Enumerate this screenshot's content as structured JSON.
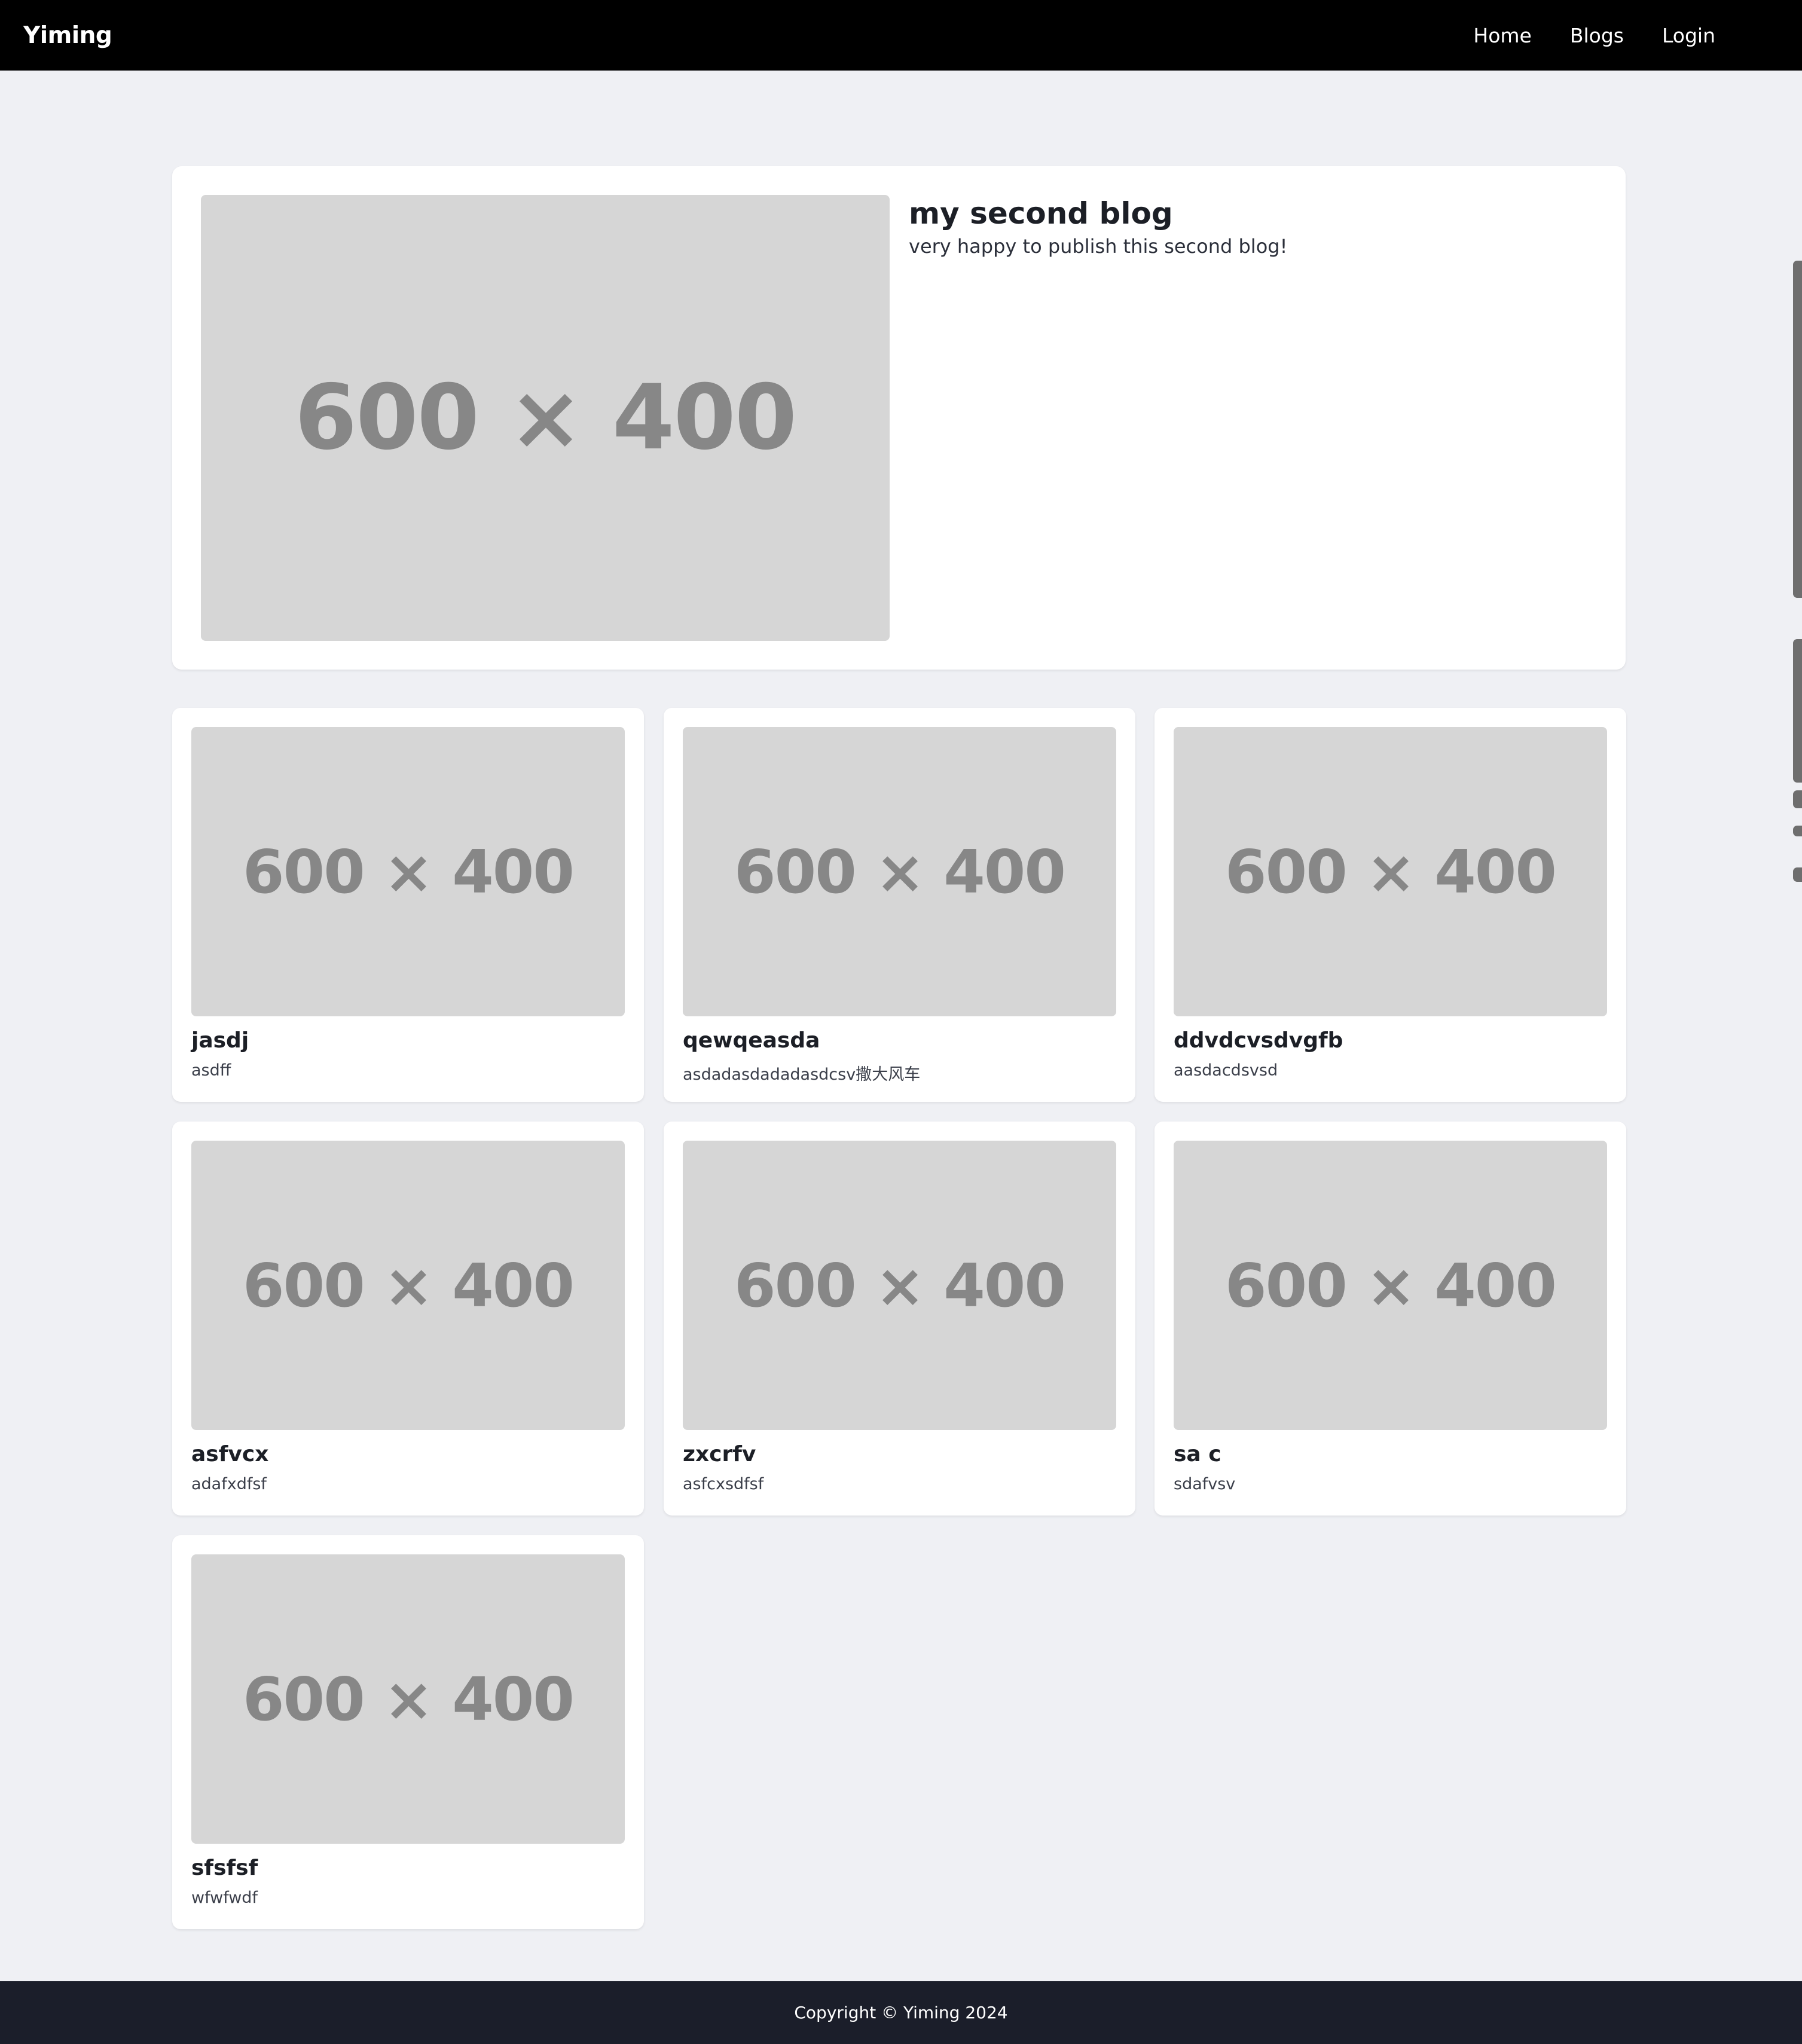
{
  "navbar": {
    "brand": "Yiming",
    "links": [
      "Home",
      "Blogs",
      "Login"
    ]
  },
  "hero": {
    "image_text": "600 × 400",
    "title": "my second blog",
    "description": "very happy to publish this second blog!"
  },
  "cards": [
    {
      "image_text": "600 × 400",
      "title": "jasdj",
      "subtitle": "asdff"
    },
    {
      "image_text": "600 × 400",
      "title": "qewqeasda",
      "subtitle": "asdadasdadadasdcsv撒大风车"
    },
    {
      "image_text": "600 × 400",
      "title": "ddvdcvsdvgfb",
      "subtitle": "aasdacdsvsd"
    },
    {
      "image_text": "600 × 400",
      "title": "asfvcx",
      "subtitle": "adafxdfsf"
    },
    {
      "image_text": "600 × 400",
      "title": "zxcrfv",
      "subtitle": "asfcxsdfsf"
    },
    {
      "image_text": "600 × 400",
      "title": "sa c",
      "subtitle": "sdafvsv"
    },
    {
      "image_text": "600 × 400",
      "title": "sfsfsf",
      "subtitle": "wfwfwdf"
    }
  ],
  "footer": {
    "copyright": "Copyright © Yiming 2024"
  }
}
